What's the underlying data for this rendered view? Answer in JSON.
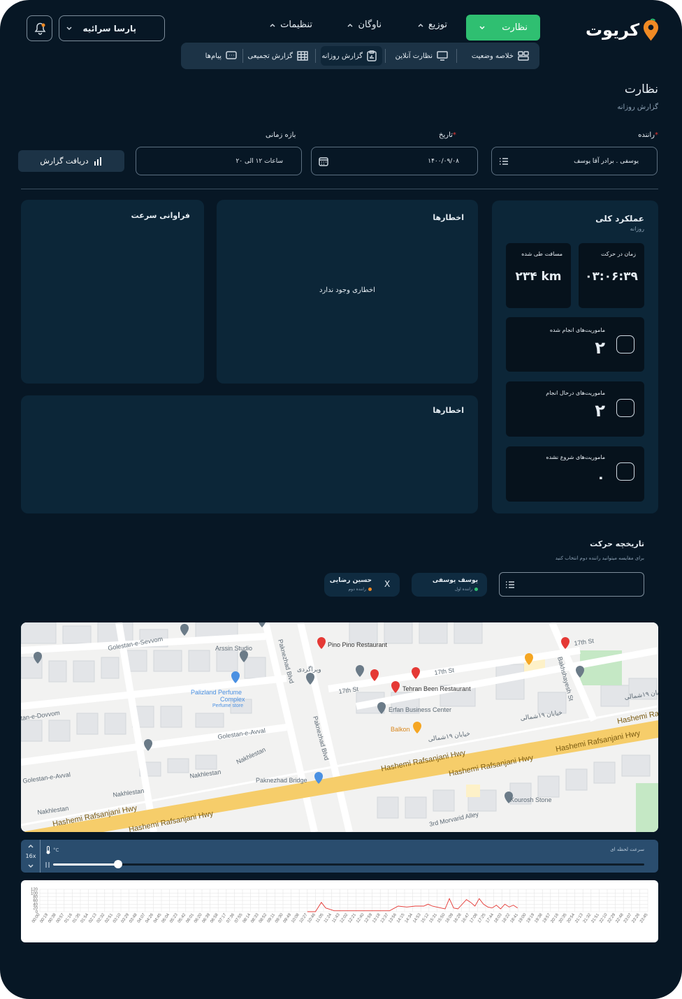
{
  "brand": {
    "logo": "کریوت",
    "accent": "#2fbf71",
    "logo_color": "#f08a24"
  },
  "header": {
    "org_select": "پارسا سرائیه",
    "nav": [
      {
        "label": "نظارت",
        "active": true
      },
      {
        "label": "توزیع"
      },
      {
        "label": "ناوگان"
      },
      {
        "label": "تنظیمات"
      }
    ],
    "subnav": [
      {
        "label": "خلاصه وضعیت",
        "icon": "dashboard-icon"
      },
      {
        "label": "نظارت آنلاین",
        "icon": "monitor-icon"
      },
      {
        "label": "گزارش روزانه",
        "icon": "clipboard-icon",
        "active": true
      },
      {
        "label": "گزارش تجمیعی",
        "icon": "table-icon"
      },
      {
        "label": "پیام‌ها",
        "icon": "message-icon"
      }
    ]
  },
  "page": {
    "title": "نظارت",
    "subtitle": "گزارش روزانه"
  },
  "filters": {
    "driver_label": "راننده",
    "driver_value": "یوسفی . برادر آقا یوسف",
    "date_label": "تاریخ",
    "date_value": "۱۴۰۰/۰۹/۰۸",
    "range_label": "بازه زمانی",
    "range_value": "ساعات ۱۲ الی ۲۰",
    "report_button": "دریافت گزارش"
  },
  "overall": {
    "title": "عملکرد کلی",
    "subtitle": "روزانه",
    "moving_time_label": "زمان در حرکت",
    "moving_time_value": "۰۳:۰۶:۳۹",
    "distance_label": "مسافت طی شده",
    "distance_value": "۲۳۴ km",
    "missions": [
      {
        "label": "ماموریت‌های انجام شده",
        "value": "۲"
      },
      {
        "label": "ماموریت‌های درحال انجام",
        "value": "۲"
      },
      {
        "label": "ماموریت‌های شروع نشده",
        "value": "۰"
      }
    ]
  },
  "alerts_card": {
    "title": "اخطارها",
    "empty": "اخطاری وجود ندارد"
  },
  "speed_card": {
    "title": "فراوانی سرعت"
  },
  "alerts_card2": {
    "title": "اخطارها"
  },
  "history": {
    "title": "تاریخچه حرکت",
    "hint": "برای مقایسه میتوانید راننده دوم انتخاب کنید",
    "driver1": {
      "name": "یوسف یوسفی",
      "role": "راننده اول",
      "dot": "#2fbf71"
    },
    "driver2": {
      "name": "حسین رضایی",
      "role": "راننده دوم",
      "dot": "#f08a24"
    },
    "close": "X"
  },
  "map": {
    "labels": [
      "Golestan-e-Sevvom",
      "Arssin Studio",
      "Paknezhad Blvd",
      "Pino Pino Restaurant",
      "17th St",
      "Tehran Been Restaurant",
      "Erfan Business Center",
      "Balkon",
      "Palizland Perfume",
      "Complex",
      "Perfume store",
      "Golestan-e-Avval",
      "Nakhlestan",
      "Hashemi Rafsanjani Hwy",
      "Paknezhad Bridge",
      "Kourosh Stone",
      "3rd Morvarid Alley",
      "Bakhshayesh St",
      "tan-e-Dovvom",
      "ویراگردی",
      "خیابان ۱۹شمالی"
    ]
  },
  "player": {
    "speed_label": "سرعت لحظه ای",
    "multiplier": "16x",
    "temp_unit": "°C"
  },
  "speed_chart": {
    "chart_data": {
      "type": "line",
      "ylim": [
        0,
        120
      ],
      "y_ticks": [
        "0",
        "20",
        "40",
        "60",
        "80",
        "100",
        "120"
      ],
      "x_ticks": [
        "00:00",
        "00:19",
        "00:38",
        "00:57",
        "01:16",
        "01:35",
        "01:54",
        "02:13",
        "02:32",
        "02:51",
        "03:10",
        "03:29",
        "03:48",
        "04:07",
        "04:26",
        "04:45",
        "05:04",
        "05:23",
        "05:42",
        "06:01",
        "06:20",
        "06:39",
        "06:58",
        "07:17",
        "07:36",
        "07:55",
        "08:14",
        "08:33",
        "08:52",
        "09:11",
        "09:30",
        "09:49",
        "10:08",
        "10:27",
        "10:46",
        "11:05",
        "11:24",
        "11:43",
        "12:02",
        "12:21",
        "12:40",
        "12:59",
        "13:18",
        "13:37",
        "13:56",
        "14:15",
        "14:34",
        "14:53",
        "15:12",
        "15:31",
        "15:50",
        "16:09",
        "16:28",
        "16:47",
        "17:06",
        "17:25",
        "17:44",
        "18:03",
        "18:22",
        "18:41",
        "19:00",
        "19:19",
        "19:38",
        "19:57",
        "20:16",
        "20:35",
        "20:54",
        "21:13",
        "21:32",
        "21:51",
        "22:10",
        "22:29",
        "22:48",
        "23:07",
        "23:26",
        "23:45"
      ],
      "series": [
        {
          "color": "#e53935",
          "points": [
            [
              "10:27",
              0
            ],
            [
              "10:46",
              0
            ],
            [
              "11:00",
              50
            ],
            [
              "11:10",
              20
            ],
            [
              "11:30",
              5
            ],
            [
              "12:00",
              5
            ],
            [
              "12:40",
              5
            ],
            [
              "13:20",
              5
            ],
            [
              "13:40",
              5
            ],
            [
              "14:00",
              30
            ],
            [
              "14:20",
              25
            ],
            [
              "14:40",
              30
            ],
            [
              "15:00",
              30
            ],
            [
              "15:10",
              40
            ],
            [
              "15:20",
              30
            ],
            [
              "15:30",
              25
            ],
            [
              "15:40",
              20
            ],
            [
              "15:50",
              15
            ],
            [
              "16:00",
              70
            ],
            [
              "16:10",
              20
            ],
            [
              "16:20",
              15
            ],
            [
              "16:40",
              65
            ],
            [
              "16:50",
              50
            ],
            [
              "17:00",
              30
            ],
            [
              "17:10",
              70
            ],
            [
              "17:20",
              40
            ],
            [
              "17:30",
              25
            ],
            [
              "17:40",
              20
            ],
            [
              "17:50",
              35
            ],
            [
              "18:00",
              15
            ],
            [
              "18:10",
              40
            ],
            [
              "18:20",
              25
            ],
            [
              "18:30",
              35
            ],
            [
              "18:40",
              20
            ]
          ]
        }
      ]
    }
  }
}
